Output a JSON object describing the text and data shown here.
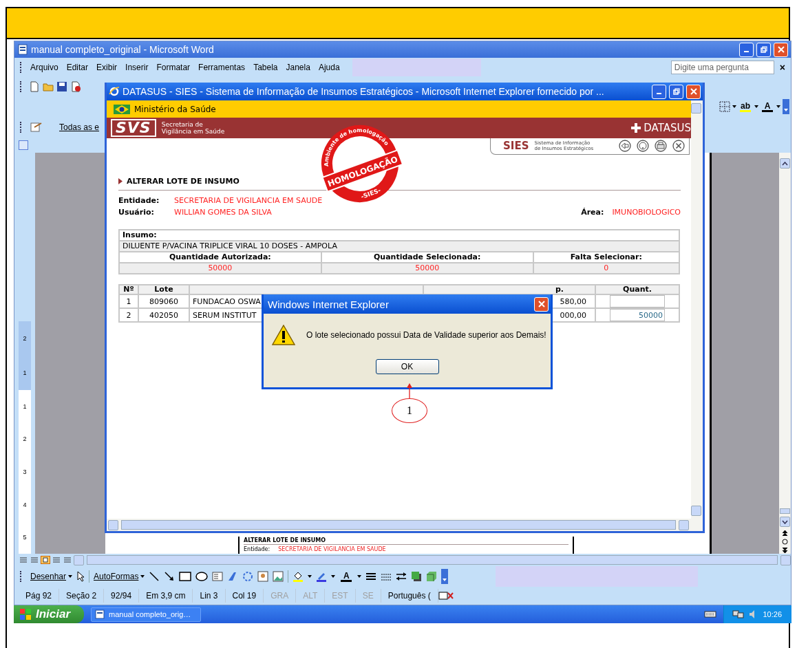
{
  "word": {
    "title": "manual completo_original - Microsoft Word",
    "menu": [
      "Arquivo",
      "Editar",
      "Exibir",
      "Inserir",
      "Formatar",
      "Ferramentas",
      "Tabela",
      "Janela",
      "Ajuda"
    ],
    "help": {
      "placeholder": "Digite uma pergunta",
      "close": "×"
    },
    "format_toolbar": {
      "highlight": "ab",
      "font_color": "A"
    },
    "style_toolbar": {
      "label": "Todas as e"
    },
    "vertical_ruler": [
      "2",
      "1",
      "1",
      "2",
      "3",
      "4",
      "5"
    ],
    "document_preview": {
      "heading": "ALTERAR LOTE DE INSUMO",
      "label": "Entidade:",
      "value": "SECRETARIA DE VIGILANCIA EM SAUDE"
    },
    "drawing_toolbar": {
      "draw": "Desenhar",
      "autoshapes": "AutoFormas",
      "font_color": "A"
    },
    "status_bar": [
      {
        "text": "Pág 92",
        "disabled": false
      },
      {
        "text": "Seção 2",
        "disabled": false
      },
      {
        "text": "92/94",
        "disabled": false
      },
      {
        "text": "Em 3,9 cm",
        "disabled": false
      },
      {
        "text": "Lin 3",
        "disabled": false
      },
      {
        "text": "Col 19",
        "disabled": false
      },
      {
        "text": "GRA",
        "disabled": true
      },
      {
        "text": "ALT",
        "disabled": true
      },
      {
        "text": "EST",
        "disabled": true
      },
      {
        "text": "SE",
        "disabled": true
      },
      {
        "text": "Português (",
        "disabled": false
      }
    ]
  },
  "taskbar": {
    "start": "Iniciar",
    "tasks": [
      {
        "label": "manual completo_orig…",
        "selected": false
      }
    ],
    "clock": "10:26"
  },
  "browser": {
    "title": "DATASUS - SIES - Sistema de Informação de Insumos Estratégicos - Microsoft Internet Explorer fornecido por ...",
    "ministry": "Ministério da Saúde",
    "svs_logo": "SVS",
    "svs_name": [
      "Secretaria de",
      "Vigilância em Saúde"
    ],
    "datasus": "DATASUS",
    "stamp": {
      "arc": "Ambiente de homologação",
      "main": "HOMOLOGAÇÃO",
      "sub": "-SIES-"
    },
    "sies": {
      "name": "SIES",
      "description": [
        "Sistema de Informação",
        "de Insumos Estratégicos"
      ]
    },
    "heading": "ALTERAR LOTE DE INSUMO",
    "fields": [
      {
        "label": "Entidade:",
        "value": "SECRETARIA DE VIGILANCIA EM SAUDE"
      },
      {
        "label": "Usuário:",
        "value": "WILLIAN GOMES DA SILVA"
      }
    ],
    "area": {
      "label": "Área:",
      "value": "IMUNOBIOLOGICO"
    },
    "insumo": {
      "label": "Insumo:",
      "value": "DILUENTE P/VACINA TRIPLICE VIRAL 10 DOSES - AMPOLA",
      "columns": [
        "Quantidade Autorizada:",
        "Quantidade Selecionada:",
        "Falta Selecionar:"
      ],
      "values": [
        "50000",
        "50000",
        "0"
      ]
    },
    "lots": {
      "columns": {
        "number": "Nº",
        "lot": "Lote",
        "column_4": "p.",
        "quantity": "Quant."
      },
      "rows": [
        {
          "number": "1",
          "lot": "809060",
          "name": "FUNDACAO OSWA",
          "column_4": "580,00"
        },
        {
          "number": "2",
          "lot": "402050",
          "name": "SERUM INSTITUT",
          "column_4": "000,00",
          "quantity": "50000"
        }
      ]
    }
  },
  "dialog": {
    "title": "Windows Internet Explorer",
    "message": "O lote selecionado possui Data de Validade superior aos Demais!",
    "button": "OK"
  },
  "callout": {
    "number": "1"
  }
}
